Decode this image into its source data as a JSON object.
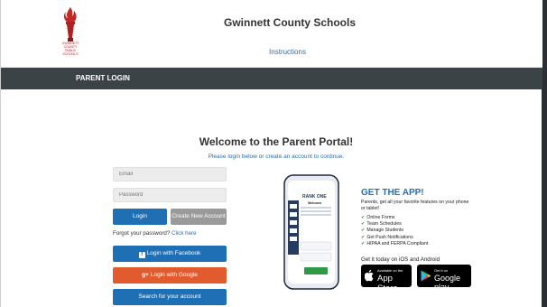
{
  "header": {
    "site_title": "Gwinnett County Schools",
    "instructions_link": "Instructions",
    "logo_lines": [
      "Gwinnett",
      "County",
      "Public",
      "Schools"
    ]
  },
  "nav": {
    "title": "PARENT LOGIN"
  },
  "welcome": {
    "title": "Welcome to the Parent Portal!",
    "subtitle": "Please login below or create an account to continue."
  },
  "login": {
    "email_placeholder": "Email",
    "password_placeholder": "Password",
    "login_label": "Login",
    "create_label": "Create New Account",
    "forgot_text": "Forgot your password?",
    "forgot_link": "Click here",
    "facebook_label": "Login with Facebook",
    "google_label": "Login with Google",
    "search_label": "Search for your account"
  },
  "app": {
    "title": "GET THE APP!",
    "description": "Parents, get all your favorite features on your phone or tablet!",
    "features": [
      "Online Forms",
      "Team Schedules",
      "Manage Students",
      "Get Push Notifications",
      "HIPAA and FERPA Compliant"
    ],
    "cta": "Get it today on iOS and Android",
    "app_store_small": "Available on the",
    "app_store_big": "App Store",
    "google_small": "Get it on",
    "google_big": "Google play",
    "phone_brand": "RANK ONE",
    "phone_welcome": "Welcome"
  },
  "colors": {
    "primary_blue": "#1f6fb5",
    "nav_bg": "#3c4347",
    "google_orange": "#e15b2e",
    "secondary_gray": "#9a9a9a",
    "logo_red": "#b02222"
  }
}
